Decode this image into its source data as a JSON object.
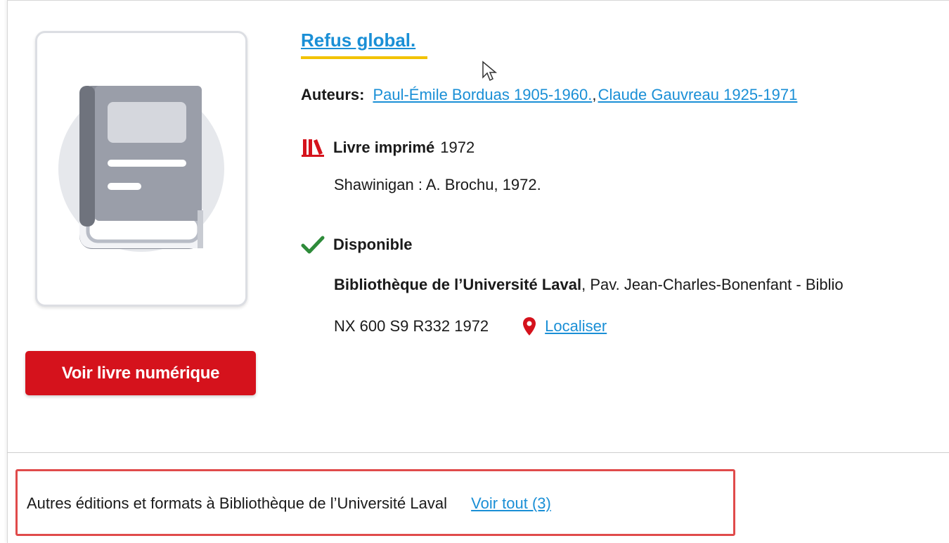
{
  "record": {
    "title": "Refus global.",
    "authors_label": "Auteurs:",
    "authors": [
      "Paul-Émile Borduas 1905-1960.",
      "Claude Gauvreau 1925-1971"
    ],
    "authors_separator": ",",
    "format_icon": "books-icon",
    "format_label": "Livre imprimé",
    "year": "1972",
    "publication": "Shawinigan : A. Brochu, 1972.",
    "availability_icon": "checkmark-icon",
    "availability": "Disponible",
    "library_name": "Bibliothèque de l’Université Laval",
    "library_location": ", Pav. Jean-Charles-Bonenfant - Biblio",
    "call_number": "NX 600 S9 R332 1972",
    "locate_icon": "map-pin-icon",
    "locate_label": "Localiser",
    "digital_button": "Voir livre numérique",
    "cover_icon": "book-placeholder-icon"
  },
  "other_editions": {
    "label": "Autres éditions et formats à Bibliothèque de l’Université Laval",
    "view_all": "Voir tout (3)"
  },
  "colors": {
    "link": "#1a8fd6",
    "accent_red": "#d5121c",
    "check_green": "#2e8b3a",
    "title_underline": "#f2c200",
    "highlight_border": "#e04b4b"
  }
}
